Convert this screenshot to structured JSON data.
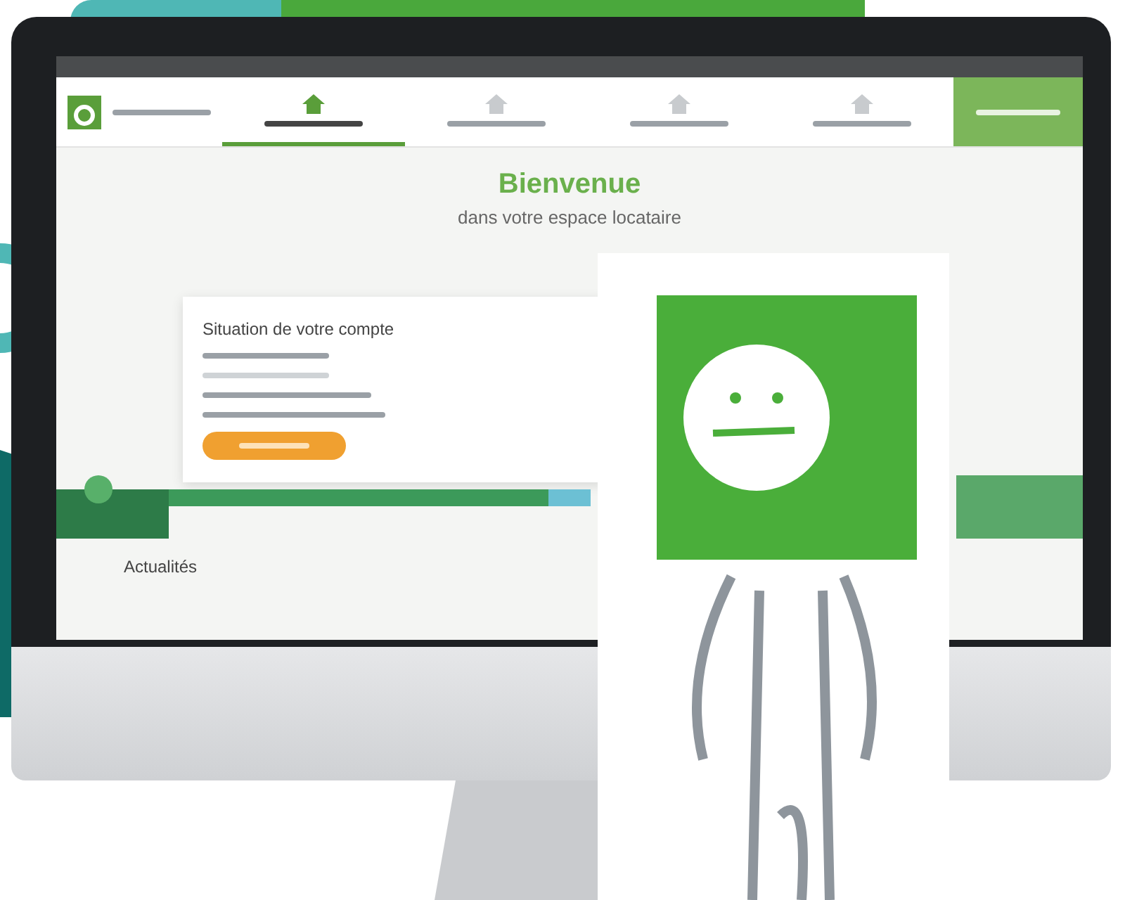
{
  "screen": {
    "nav": {
      "tabs": [
        {
          "selected": true
        },
        {
          "selected": false
        },
        {
          "selected": false
        },
        {
          "selected": false
        }
      ]
    },
    "hero": {
      "title": "Bienvenue",
      "subtitle": "dans votre espace locataire"
    },
    "account_card": {
      "title": "Situation de votre compte"
    },
    "news": {
      "title": "Actualités"
    }
  }
}
